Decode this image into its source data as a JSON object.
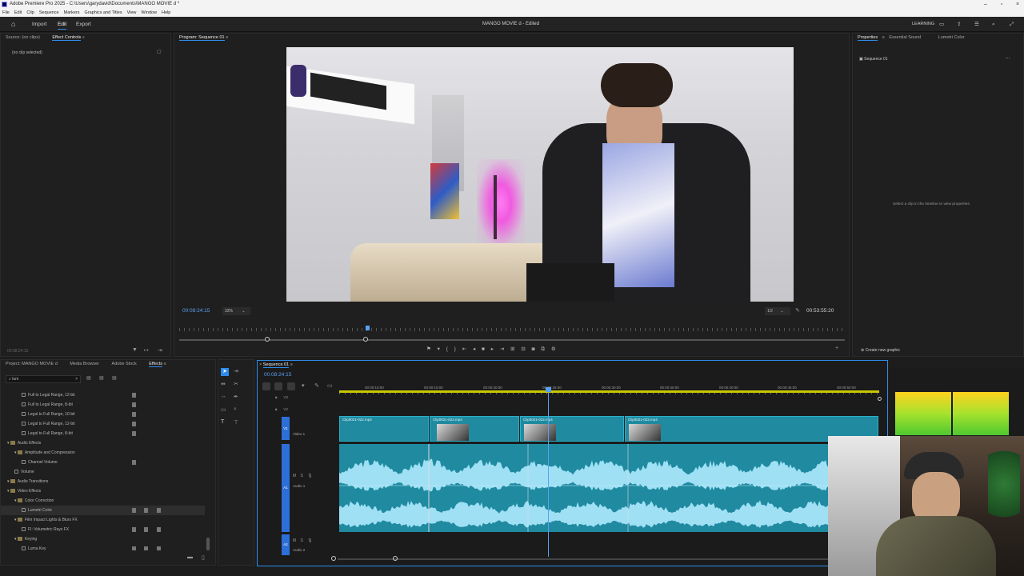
{
  "window": {
    "title": "Adobe Premiere Pro 2025 - C:\\Users\\garydavid\\Documents\\MANGO MOVIE d *"
  },
  "menu": [
    "File",
    "Edit",
    "Clip",
    "Sequence",
    "Markers",
    "Graphics and Titles",
    "View",
    "Window",
    "Help"
  ],
  "workspace": {
    "tabs": [
      "Import",
      "Edit",
      "Export"
    ],
    "active": "Edit",
    "project_title": "MANGO MOVIE d",
    "status": "- Edited",
    "learning": "LEARNING"
  },
  "source_panel": {
    "tabs": [
      "Source: (no clips)",
      "Effect Controls"
    ],
    "active": "Effect Controls",
    "empty_text": "(no clip selected)",
    "timecode": "00:08:24:15"
  },
  "program": {
    "title": "Program: Sequence 01",
    "timecode": "00:08:24:15",
    "zoom": "33%",
    "resolution": "1/2",
    "duration": "00:53:55:20"
  },
  "properties": {
    "tabs": [
      "Properties",
      "Essential Sound",
      "Lumetri Color"
    ],
    "active": "Properties",
    "sequence": "Sequence 01",
    "hint": "Select a clip in the timeline to view properties.",
    "create_graphic": "Create new graphic"
  },
  "effects_panel": {
    "tabs": [
      "Project: MANGO MOVIE d",
      "Media Browser",
      "Adobe Stock",
      "Effects"
    ],
    "active": "Effects",
    "search": "lum",
    "items": [
      {
        "label": "Full to Legal Range, 12-bit",
        "indent": 2,
        "kind": "fx"
      },
      {
        "label": "Full to Legal Range, 8-bit",
        "indent": 2,
        "kind": "fx"
      },
      {
        "label": "Legal to Full Range, 10-bit",
        "indent": 2,
        "kind": "fx"
      },
      {
        "label": "Legal to Full Range, 12-bit",
        "indent": 2,
        "kind": "fx"
      },
      {
        "label": "Legal to Full Range, 8-bit",
        "indent": 2,
        "kind": "fx"
      },
      {
        "label": "Audio Effects",
        "indent": 0,
        "kind": "folder"
      },
      {
        "label": "Amplitude and Compression",
        "indent": 1,
        "kind": "folder"
      },
      {
        "label": "Channel Volume",
        "indent": 2,
        "kind": "fx"
      },
      {
        "label": "Volume",
        "indent": 1,
        "kind": "fx"
      },
      {
        "label": "Audio Transitions",
        "indent": 0,
        "kind": "folder"
      },
      {
        "label": "Video Effects",
        "indent": 0,
        "kind": "folder"
      },
      {
        "label": "Color Correction",
        "indent": 1,
        "kind": "folder"
      },
      {
        "label": "Lumetri Color",
        "indent": 2,
        "kind": "fx",
        "selected": true
      },
      {
        "label": "Film Impact Lights & Blurs FX",
        "indent": 1,
        "kind": "folder"
      },
      {
        "label": "FI: Volumetric Rays FX",
        "indent": 2,
        "kind": "fx"
      },
      {
        "label": "Keying",
        "indent": 1,
        "kind": "folder"
      },
      {
        "label": "Luma Key",
        "indent": 2,
        "kind": "fx"
      }
    ]
  },
  "timeline": {
    "sequence_tab": "Sequence 01",
    "timecode": "00:08:24:15",
    "ruler": [
      "00:00:10:00",
      "00:00:15:00",
      "00:00:20:00",
      "00:00:25:00",
      "00:00:30:00",
      "00:00:35:00",
      "00:00:40:00",
      "00:00:45:00",
      "00:00:50:00"
    ],
    "tracks": {
      "v3": "V3",
      "v2": "V2",
      "v1": "V1",
      "video1": "Video 1",
      "a1": "A1",
      "audio1": "Audio 1",
      "a2": "A2",
      "audio2": "Audio 2"
    },
    "clips": [
      "Clip0021-022.mp4",
      "Clip0021-022.mp4",
      "Clip0021-022.mp4",
      "Clip0021-022.mp4"
    ]
  },
  "colors": {
    "accent": "#2d8ceb",
    "clip": "#1f8aa0",
    "timecode": "#5aa0f0"
  }
}
